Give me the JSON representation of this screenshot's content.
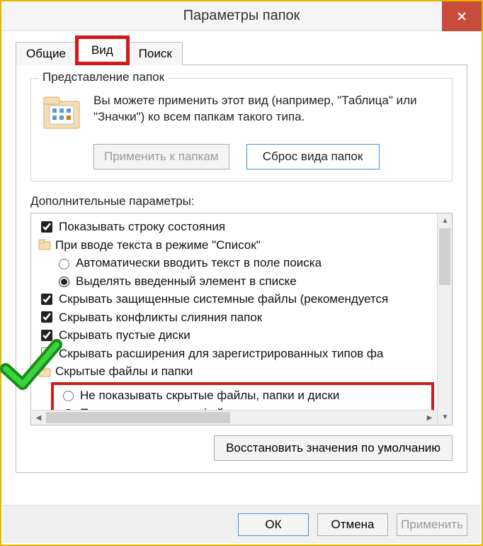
{
  "window": {
    "title": "Параметры папок"
  },
  "tabs": {
    "general": "Общие",
    "view": "Вид",
    "search": "Поиск"
  },
  "folderViews": {
    "groupTitle": "Представление папок",
    "description": "Вы можете применить этот вид (например, \"Таблица\" или \"Значки\") ко всем папкам такого типа.",
    "applyBtn": "Применить к папкам",
    "resetBtn": "Сброс вида папок"
  },
  "advanced": {
    "label": "Дополнительные параметры:",
    "items": {
      "statusBar": "Показывать строку состояния",
      "listMode": "При вводе текста в режиме \"Список\"",
      "autoType": "Автоматически вводить текст в поле поиска",
      "selectTyped": "Выделять введенный элемент в списке",
      "hideProtected": "Скрывать защищенные системные файлы (рекомендуется",
      "hideMergeConflicts": "Скрывать конфликты слияния папок",
      "hideEmptyDrives": "Скрывать пустые диски",
      "hideExtensions": "Скрывать расширения для зарегистрированных типов фа",
      "hiddenGroup": "Скрытые файлы и папки",
      "dontShowHidden": "Не показывать скрытые файлы, папки и диски",
      "showHidden": "Показывать скрытые файлы, папки и диски"
    },
    "restoreBtn": "Восстановить значения по умолчанию"
  },
  "footer": {
    "ok": "ОК",
    "cancel": "Отмена",
    "apply": "Применить"
  }
}
